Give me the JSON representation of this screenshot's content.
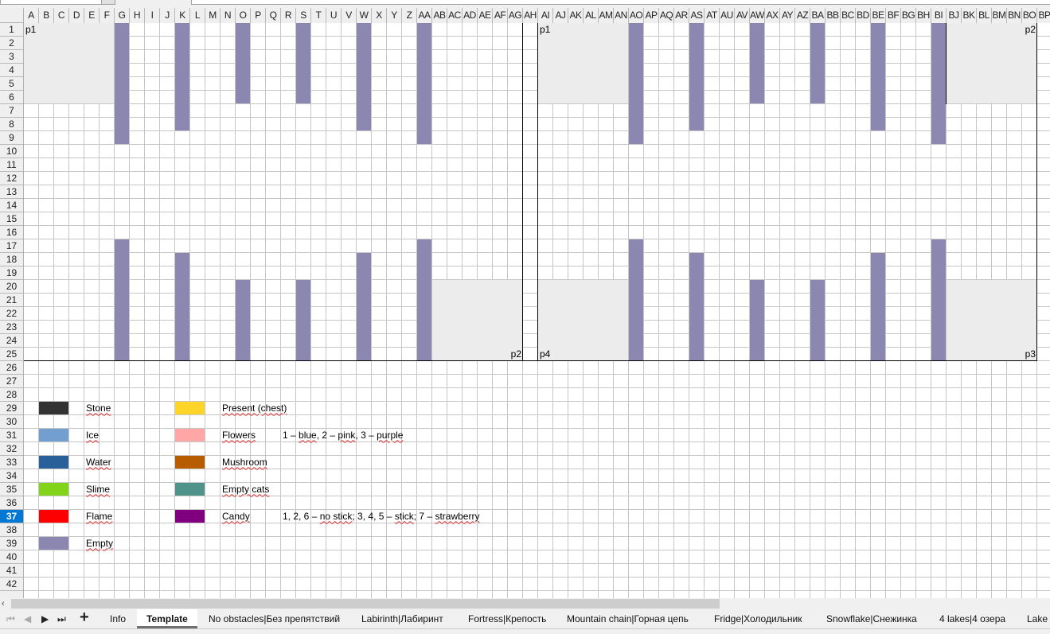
{
  "spreadsheet": {
    "columns": [
      "A",
      "B",
      "C",
      "D",
      "E",
      "F",
      "G",
      "H",
      "I",
      "J",
      "K",
      "L",
      "M",
      "N",
      "O",
      "P",
      "Q",
      "R",
      "S",
      "T",
      "U",
      "V",
      "W",
      "X",
      "Y",
      "Z",
      "AA",
      "AB",
      "AC",
      "AD",
      "AE",
      "AF",
      "AG",
      "AH",
      "AI",
      "AJ",
      "AK",
      "AL",
      "AM",
      "AN",
      "AO",
      "AP",
      "AQ",
      "AR",
      "AS",
      "AT",
      "AU",
      "AV",
      "AW",
      "AX",
      "AY",
      "AZ",
      "BA",
      "BB",
      "BC",
      "BD",
      "BE",
      "BF",
      "BG",
      "BH",
      "BI",
      "BJ",
      "BK",
      "BL",
      "BM",
      "BN",
      "BO",
      "BP"
    ],
    "rows": [
      "1",
      "2",
      "3",
      "4",
      "5",
      "6",
      "7",
      "8",
      "9",
      "10",
      "11",
      "12",
      "13",
      "14",
      "15",
      "16",
      "17",
      "18",
      "19",
      "20",
      "21",
      "22",
      "23",
      "24",
      "25",
      "26",
      "27",
      "28",
      "29",
      "30",
      "31",
      "32",
      "33",
      "34",
      "35",
      "36",
      "37",
      "38",
      "39",
      "40",
      "41",
      "42"
    ],
    "active_row": "37",
    "colors": {
      "empty_purple": "#8c87b0",
      "portal_gray": "#ececec",
      "grid": "#c6c6c6",
      "active_header": "#0078d4"
    },
    "filled_ranges": [
      {
        "range": "A1:F6",
        "color": "#ececec"
      },
      {
        "range": "G1:G9",
        "color": "#8c87b0"
      },
      {
        "range": "K1:K8",
        "color": "#8c87b0"
      },
      {
        "range": "O1:O6",
        "color": "#8c87b0"
      },
      {
        "range": "S1:S6",
        "color": "#8c87b0"
      },
      {
        "range": "W1:W8",
        "color": "#8c87b0"
      },
      {
        "range": "AA1:AA9",
        "color": "#8c87b0"
      },
      {
        "range": "G17:G25",
        "color": "#8c87b0"
      },
      {
        "range": "K18:K25",
        "color": "#8c87b0"
      },
      {
        "range": "O20:O25",
        "color": "#8c87b0"
      },
      {
        "range": "S20:S25",
        "color": "#8c87b0"
      },
      {
        "range": "W18:W25",
        "color": "#8c87b0"
      },
      {
        "range": "AA17:AA25",
        "color": "#8c87b0"
      },
      {
        "range": "AB20:AG25",
        "color": "#ececec"
      },
      {
        "range": "AI1:AN6",
        "color": "#ececec"
      },
      {
        "range": "AO1:AO9",
        "color": "#8c87b0"
      },
      {
        "range": "AS1:AS8",
        "color": "#8c87b0"
      },
      {
        "range": "AW1:AW6",
        "color": "#8c87b0"
      },
      {
        "range": "BA1:BA6",
        "color": "#8c87b0"
      },
      {
        "range": "BE1:BE8",
        "color": "#8c87b0"
      },
      {
        "range": "BI1:BI9",
        "color": "#8c87b0"
      },
      {
        "range": "BJ1:BO6",
        "color": "#ececec"
      },
      {
        "range": "AI20:AN25",
        "color": "#ececec"
      },
      {
        "range": "AO17:AO25",
        "color": "#8c87b0"
      },
      {
        "range": "AS18:AS25",
        "color": "#8c87b0"
      },
      {
        "range": "AW20:AW25",
        "color": "#8c87b0"
      },
      {
        "range": "BA20:BA25",
        "color": "#8c87b0"
      },
      {
        "range": "BE18:BE25",
        "color": "#8c87b0"
      },
      {
        "range": "BI17:BI25",
        "color": "#8c87b0"
      },
      {
        "range": "BJ20:BO25",
        "color": "#ececec"
      }
    ],
    "portal_labels": [
      {
        "cell": "A1",
        "text": "p1",
        "align": "left"
      },
      {
        "cell": "AG25",
        "text": "p2",
        "align": "right"
      },
      {
        "cell": "AI1",
        "text": "p1",
        "align": "left"
      },
      {
        "cell": "BO1",
        "text": "p2",
        "align": "right"
      },
      {
        "cell": "AI25",
        "text": "p4",
        "align": "left"
      },
      {
        "cell": "BO25",
        "text": "p3",
        "align": "right"
      }
    ],
    "legend": [
      {
        "swatch": "B29:C29",
        "label_cell": "E29",
        "label": "Stone",
        "color": "#333333",
        "spell": true
      },
      {
        "swatch": "B31:C31",
        "label_cell": "E31",
        "label": "Ice",
        "color": "#729fcf",
        "spell": true
      },
      {
        "swatch": "B33:C33",
        "label_cell": "E33",
        "label": "Water",
        "color": "#2a6099",
        "spell": true
      },
      {
        "swatch": "B35:C35",
        "label_cell": "E35",
        "label": "Slime",
        "color": "#81d41a",
        "spell": true
      },
      {
        "swatch": "B37:C37",
        "label_cell": "E37",
        "label": "Flame",
        "color": "#ff0000",
        "spell": true
      },
      {
        "swatch": "B39:C39",
        "label_cell": "E39",
        "label": "Empty",
        "color": "#8c87b0",
        "spell": true
      },
      {
        "swatch": "K29:L29",
        "label_cell": "N29",
        "label": "Present (chest)",
        "color": "#ffd428",
        "spell": true
      },
      {
        "swatch": "K31:L31",
        "label_cell": "N31",
        "label": "Flowers",
        "color": "#ffa6a6",
        "spell": true
      },
      {
        "swatch": "K33:L33",
        "label_cell": "N33",
        "label": "Mushroom",
        "color": "#b85c00",
        "spell": true
      },
      {
        "swatch": "K35:L35",
        "label_cell": "N35",
        "label": "Empty cats",
        "color": "#50938a",
        "spell": true
      },
      {
        "swatch": "K37:L37",
        "label_cell": "N37",
        "label": "Candy",
        "color": "#800080",
        "spell": true
      }
    ],
    "notes": [
      {
        "cell": "R31",
        "text": "1 – blue, 2 – pink, 3 – purple"
      },
      {
        "cell": "R37",
        "text": "1, 2, 6 – no stick; 3, 4, 5 – stick; 7 – strawberry"
      }
    ]
  },
  "scrollbar": {
    "left_arrow": "‹"
  },
  "tabbar": {
    "nav": {
      "first": "⏮",
      "prev": "◀",
      "next": "▶",
      "last": "⏭",
      "add": "+"
    },
    "tabs": [
      "Info",
      "Template",
      "No obstacles|Без препятствий",
      "Labirinth|Лабиринт",
      "Fortress|Крепость",
      "Mountain chain|Горная цепь",
      "Fridge|Холодильник",
      "Snowflake|Снежинка",
      "4 lakes|4 озера",
      "Lake v"
    ],
    "active_tab": "Template"
  }
}
